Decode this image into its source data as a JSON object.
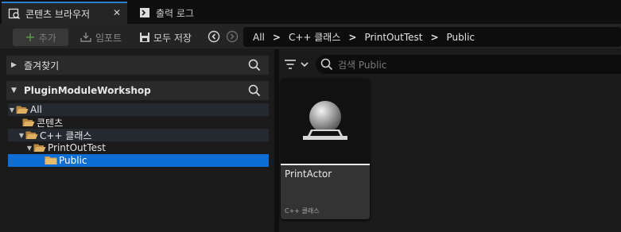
{
  "tabs": [
    {
      "label": "콘텐츠 브라우저",
      "icon": "content-browser-icon",
      "close": "✕"
    },
    {
      "label": "출력 로그",
      "icon": "output-log-icon"
    }
  ],
  "toolbar": {
    "add_label": "추가",
    "import_label": "임포트",
    "save_all_label": "모두 저장"
  },
  "breadcrumb": [
    "All",
    "C++ 클래스",
    "PrintOutTest",
    "Public"
  ],
  "left_panel": {
    "favorites_label": "즐겨찾기",
    "project_label": "PluginModuleWorkshop",
    "tree": [
      {
        "label": "All",
        "depth": 0,
        "expanded": true
      },
      {
        "label": "콘텐츠",
        "depth": 1,
        "expanded": false
      },
      {
        "label": "C++ 클래스",
        "depth": 1,
        "expanded": true
      },
      {
        "label": "PrintOutTest",
        "depth": 2,
        "expanded": true
      },
      {
        "label": "Public",
        "depth": 3,
        "expanded": false,
        "selected": true
      }
    ]
  },
  "right_panel": {
    "search_placeholder": "검색 Public",
    "assets": [
      {
        "name": "PrintActor",
        "type": "C++ 클래스"
      }
    ]
  },
  "colors": {
    "accent": "#2a7fd4",
    "selection": "#0d6ed6",
    "add_green": "#5aa24a",
    "folder": "#d9a85b"
  }
}
